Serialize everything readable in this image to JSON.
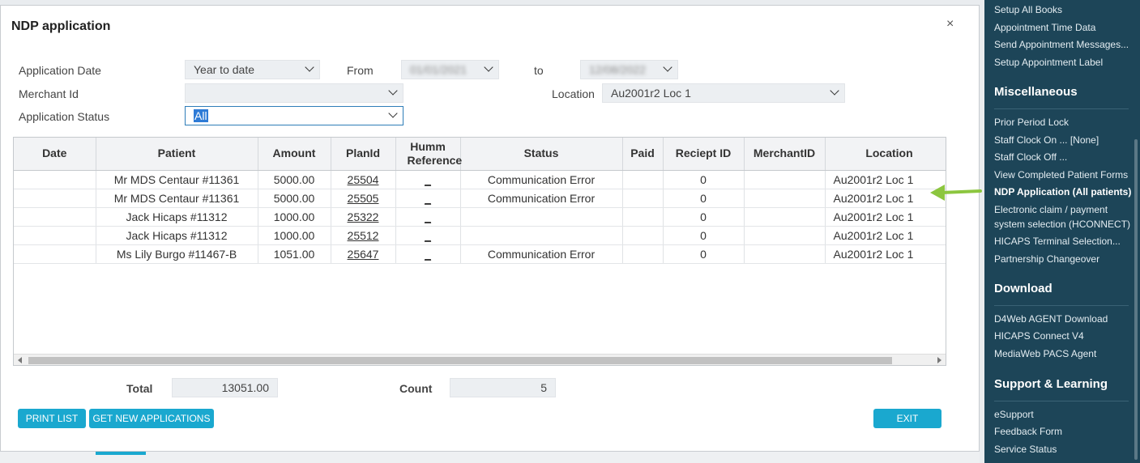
{
  "dialog": {
    "title": "NDP application",
    "close_glyph": "×"
  },
  "filters": {
    "application_date_label": "Application Date",
    "application_date_value": "Year to date",
    "from_label": "From",
    "from_value": "01/01/2021",
    "to_label": "to",
    "to_value": "12/08/2022",
    "merchant_id_label": "Merchant Id",
    "merchant_id_value": "",
    "location_label": "Location",
    "location_value": "Au2001r2 Loc 1",
    "status_label": "Application Status",
    "status_value": "All"
  },
  "table": {
    "columns": [
      "Date",
      "Patient",
      "Amount",
      "PlanId",
      "Humm Reference",
      "Status",
      "Paid",
      "Reciept ID",
      "MerchantID",
      "Location"
    ],
    "rows": [
      {
        "date": "",
        "patient": "Mr MDS Centaur #11361",
        "amount": "5000.00",
        "plan_id": "25504",
        "humm_ref": "_",
        "status": "Communication Error",
        "paid": "",
        "receipt_id": "0",
        "merchant_id": "",
        "location": "Au2001r2 Loc 1"
      },
      {
        "date": "",
        "patient": "Mr MDS Centaur #11361",
        "amount": "5000.00",
        "plan_id": "25505",
        "humm_ref": "_",
        "status": "Communication Error",
        "paid": "",
        "receipt_id": "0",
        "merchant_id": "",
        "location": "Au2001r2 Loc 1"
      },
      {
        "date": "",
        "patient": "Jack Hicaps #11312",
        "amount": "1000.00",
        "plan_id": "25322",
        "humm_ref": "_",
        "status": "",
        "paid": "",
        "receipt_id": "0",
        "merchant_id": "",
        "location": "Au2001r2 Loc 1"
      },
      {
        "date": "",
        "patient": "Jack Hicaps #11312",
        "amount": "1000.00",
        "plan_id": "25512",
        "humm_ref": "_",
        "status": "",
        "paid": "",
        "receipt_id": "0",
        "merchant_id": "",
        "location": "Au2001r2 Loc 1"
      },
      {
        "date": "",
        "patient": "Ms Lily Burgo #11467-B",
        "amount": "1051.00",
        "plan_id": "25647",
        "humm_ref": "_",
        "status": "Communication Error",
        "paid": "",
        "receipt_id": "0",
        "merchant_id": "",
        "location": "Au2001r2 Loc 1"
      }
    ]
  },
  "totals": {
    "total_label": "Total",
    "total_value": "13051.00",
    "count_label": "Count",
    "count_value": "5"
  },
  "buttons": {
    "print_list": "PRINT LIST",
    "get_new_applications": "GET NEW APPLICATIONS",
    "exit": "EXIT"
  },
  "colors": {
    "button": "#1aa8cf",
    "sidebar_bg": "#1d4558",
    "arrow": "#8cc63f",
    "selection": "#2e7bd6"
  },
  "sidebar": {
    "top_items": [
      "Setup All Books",
      "Appointment Time Data",
      "Send Appointment Messages...",
      "Setup Appointment Label"
    ],
    "miscellaneous_heading": "Miscellaneous",
    "miscellaneous_items": [
      "Prior Period Lock",
      "Staff Clock On ... [None]",
      "Staff Clock Off ...",
      "View Completed Patient Forms",
      "NDP Application (All patients)",
      "Electronic claim / payment",
      "system selection (HCONNECT)",
      "HICAPS Terminal Selection...",
      "Partnership Changeover"
    ],
    "download_heading": "Download",
    "download_items": [
      "D4Web AGENT Download",
      "HICAPS Connect V4",
      "MediaWeb PACS Agent"
    ],
    "support_heading": "Support & Learning",
    "support_items": [
      "eSupport",
      "Feedback Form",
      "Service Status"
    ]
  }
}
